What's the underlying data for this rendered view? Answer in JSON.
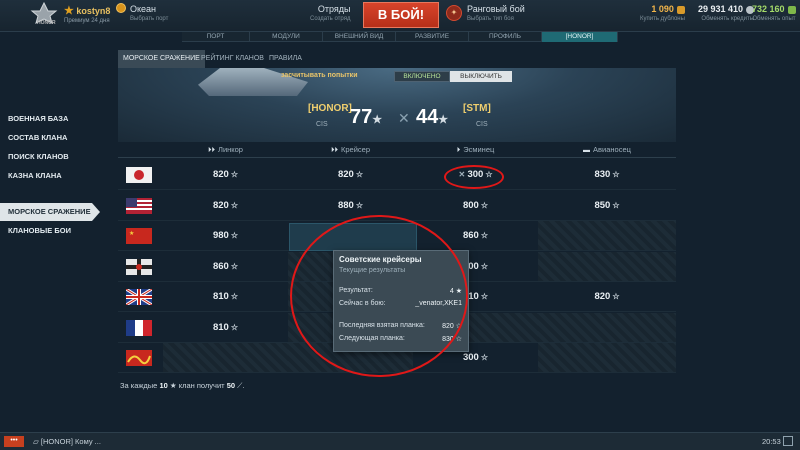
{
  "topbar": {
    "logo_text": "HONOR",
    "user": {
      "name": "kostyn8",
      "status": "Премиум 24 дня"
    },
    "port": {
      "title": "Океан",
      "subtitle": "Выбрать порт"
    },
    "squad": {
      "title": "Отряды",
      "subtitle": "Создать отряд"
    },
    "battle_button": "В БОЙ!",
    "ranked": {
      "title": "Ранговый бой",
      "subtitle": "Выбрать тип боя",
      "icon": "ranked-emblem-icon"
    },
    "currencies": [
      {
        "value": "1 090",
        "label": "Купить дублоны",
        "icon": "doubloon-icon"
      },
      {
        "value": "29 931 410",
        "label": "Обменять кредиты",
        "icon": "credits-icon"
      },
      {
        "value": "732 160",
        "label": "Обменять опыт",
        "icon": "free-xp-icon"
      }
    ]
  },
  "nav": {
    "tabs": [
      "ПОРТ",
      "МОДУЛИ",
      "ВНЕШНИЙ ВИД",
      "РАЗВИТИЕ",
      "ПРОФИЛЬ",
      "[HONOR]"
    ],
    "active": 5
  },
  "subtabs": {
    "items": [
      "МОРСКОЕ СРАЖЕНИЕ",
      "РЕЙТИНГ КЛАНОВ",
      "ПРАВИЛА"
    ],
    "active": 0
  },
  "banner": {
    "retry_label": "засчитывать попытки",
    "on_label": "ВКЛЮЧЕНО",
    "off_label": "ВЫКЛЮЧИТЬ",
    "clan_a": {
      "tag": "[HONOR]",
      "server": "CIS",
      "score": "77"
    },
    "clan_b": {
      "tag": "[STM]",
      "server": "CIS",
      "score": "44"
    }
  },
  "sidebar": {
    "items": [
      "ВОЕННАЯ БАЗА",
      "СОСТАВ КЛАНА",
      "ПОИСК КЛАНОВ",
      "КАЗНА КЛАНА",
      "МОРСКОЕ СРАЖЕНИЕ",
      "КЛАНОВЫЕ БОИ"
    ],
    "active": 4
  },
  "table": {
    "columns": [
      {
        "label": "Линкор",
        "icon": "battleship-icon"
      },
      {
        "label": "Крейсер",
        "icon": "cruiser-icon"
      },
      {
        "label": "Эсминец",
        "icon": "destroyer-icon"
      },
      {
        "label": "Авианосец",
        "icon": "carrier-icon"
      }
    ],
    "rows": [
      {
        "nation": "japan-flag",
        "cells": [
          "820",
          "820",
          "300",
          "830"
        ]
      },
      {
        "nation": "usa-flag",
        "cells": [
          "820",
          "880",
          "800",
          "850"
        ]
      },
      {
        "nation": "ussr-flag",
        "cells": [
          "980",
          "830",
          "860",
          ""
        ]
      },
      {
        "nation": "germany-flag",
        "cells": [
          "860",
          "",
          "300",
          ""
        ]
      },
      {
        "nation": "uk-flag",
        "cells": [
          "810",
          "",
          "810",
          "820"
        ]
      },
      {
        "nation": "france-flag",
        "cells": [
          "810",
          "",
          "",
          ""
        ]
      },
      {
        "nation": "pan-asia-flag",
        "cells": [
          "",
          "",
          "300",
          ""
        ]
      }
    ],
    "star": "☆"
  },
  "tooltip": {
    "title": "Советские крейсеры",
    "subtitle": "Текущие результаты",
    "result_label": "Результат:",
    "result_value": "4",
    "in_battle_label": "Сейчас в бою:",
    "in_battle_value": "_venator,XKE1",
    "last_label": "Последняя взятая планка:",
    "last_value": "820",
    "next_label": "Следующая планка:",
    "next_value": "830"
  },
  "footnote": {
    "prefix": "За каждые",
    "n": "10",
    "mid": "клан получит",
    "reward": "50",
    "suffix": "."
  },
  "bottombar": {
    "menu": "•••",
    "chat": "[HONOR] Кому ...",
    "time": "20:53"
  },
  "colors": {
    "accent": "#1f6a74",
    "battle": "#c7391f",
    "highlight_ring": "#e01818",
    "gold": "#f0cf6e"
  }
}
